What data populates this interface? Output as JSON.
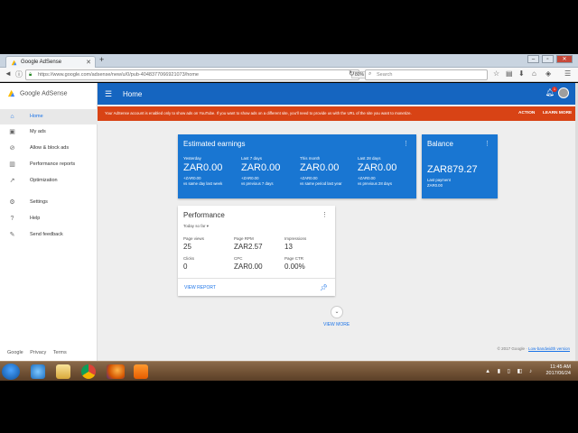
{
  "browser": {
    "tab_title": "Google AdSense",
    "new_tab": "+",
    "url": "https://www.google.com/adsense/new/u/0/pub-4048377066921073/home",
    "zoom": "80%",
    "search_placeholder": "Search"
  },
  "app": {
    "brand": "Google AdSense",
    "page_title": "Home",
    "notification_count": "1"
  },
  "sidebar": {
    "items": [
      {
        "label": "Home",
        "icon": "home-icon"
      },
      {
        "label": "My ads",
        "icon": "ads-icon"
      },
      {
        "label": "Allow & block ads",
        "icon": "block-icon"
      },
      {
        "label": "Performance reports",
        "icon": "bar-chart-icon"
      },
      {
        "label": "Optimization",
        "icon": "trending-icon"
      },
      {
        "label": "Settings",
        "icon": "gear-icon"
      },
      {
        "label": "Help",
        "icon": "help-icon"
      },
      {
        "label": "Send feedback",
        "icon": "feedback-icon"
      }
    ],
    "footer": [
      "Google",
      "Privacy",
      "Terms"
    ]
  },
  "banner": {
    "message": "Your AdSense account is enabled only to show ads on YouTube. If you want to show ads on a different site, you'll need to provide us with the URL of the site you want to monetize.",
    "action": "ACTION",
    "learn_more": "LEARN MORE"
  },
  "earnings": {
    "title": "Estimated earnings",
    "metrics": [
      {
        "label": "Yesterday",
        "value": "ZAR0.00",
        "change": "+ZAR0.00",
        "note": "vs same day last week"
      },
      {
        "label": "Last 7 days",
        "value": "ZAR0.00",
        "change": "+ZAR0.00",
        "note": "vs previous 7 days"
      },
      {
        "label": "This month",
        "value": "ZAR0.00",
        "change": "+ZAR0.00",
        "note": "vs same period last year"
      },
      {
        "label": "Last 28 days",
        "value": "ZAR0.00",
        "change": "+ZAR0.00",
        "note": "vs previous 28 days"
      }
    ]
  },
  "balance": {
    "title": "Balance",
    "value": "ZAR879.27",
    "last_payment_label": "Last payment",
    "last_payment_value": "ZAR0.00"
  },
  "performance": {
    "title": "Performance",
    "range": "Today so far",
    "metrics": [
      {
        "label": "Page views",
        "value": "25"
      },
      {
        "label": "Page RPM",
        "value": "ZAR2.57"
      },
      {
        "label": "Impressions",
        "value": "13"
      },
      {
        "label": "Clicks",
        "value": "0"
      },
      {
        "label": "CPC",
        "value": "ZAR0.00"
      },
      {
        "label": "Page CTR",
        "value": "0.00%"
      }
    ],
    "view_report": "VIEW REPORT"
  },
  "view_more": "VIEW MORE",
  "copyright": "© 2017 Google ·",
  "low_bandwidth": "Low-bandwidth version",
  "taskbar": {
    "time": "11:45 AM",
    "date": "2017/06/24"
  },
  "colors": {
    "primary": "#1565c0",
    "card_blue": "#1976d2",
    "banner": "#d84315"
  }
}
